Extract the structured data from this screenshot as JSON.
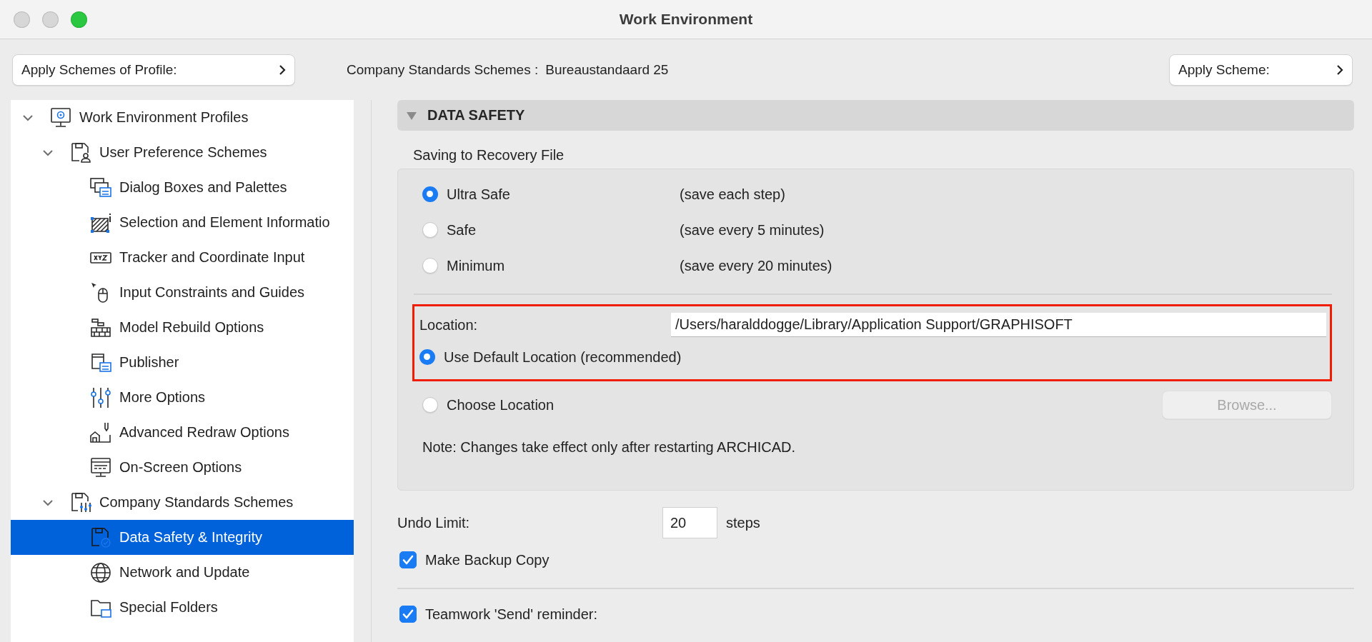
{
  "window": {
    "title": "Work Environment"
  },
  "toolbar": {
    "profile_button": "Apply Schemes of Profile:",
    "scheme_label": "Company Standards Schemes :",
    "scheme_value": "Bureaustandaard 25",
    "apply_button": "Apply Scheme:"
  },
  "tree": [
    {
      "label": "Work Environment Profiles",
      "expanded": true,
      "selected": false,
      "children": [
        {
          "label": "User Preference Schemes",
          "expanded": true,
          "selected": false,
          "children": [
            {
              "label": "Dialog Boxes and Palettes",
              "selected": false
            },
            {
              "label": "Selection and Element Informatio",
              "selected": false
            },
            {
              "label": "Tracker and Coordinate Input",
              "selected": false
            },
            {
              "label": "Input Constraints and Guides",
              "selected": false
            },
            {
              "label": "Model Rebuild Options",
              "selected": false
            },
            {
              "label": "Publisher",
              "selected": false
            },
            {
              "label": "More Options",
              "selected": false
            },
            {
              "label": "Advanced Redraw Options",
              "selected": false
            },
            {
              "label": "On-Screen Options",
              "selected": false
            }
          ]
        },
        {
          "label": "Company Standards Schemes",
          "expanded": true,
          "selected": false,
          "children": [
            {
              "label": "Data Safety & Integrity",
              "selected": true
            },
            {
              "label": "Network and Update",
              "selected": false
            },
            {
              "label": "Special Folders",
              "selected": false
            }
          ]
        }
      ]
    }
  ],
  "section": {
    "title": "DATA SAFETY",
    "expanded": true
  },
  "recovery": {
    "heading": "Saving to Recovery File",
    "options": [
      {
        "label": "Ultra Safe",
        "note": "(save each step)",
        "selected": true
      },
      {
        "label": "Safe",
        "note": "(save every 5 minutes)",
        "selected": false
      },
      {
        "label": "Minimum",
        "note": "(save every 20 minutes)",
        "selected": false
      }
    ]
  },
  "location": {
    "label": "Location:",
    "value": "/Users/haralddogge/Library/Application Support/GRAPHISOFT"
  },
  "location_modes": [
    {
      "label": "Use Default Location (recommended)",
      "selected": true
    },
    {
      "label": "Choose Location",
      "selected": false
    }
  ],
  "browse_button": {
    "label": "Browse...",
    "disabled": true
  },
  "note": "Note: Changes take effect only after restarting ARCHICAD.",
  "undo": {
    "label": "Undo Limit:",
    "value": "20",
    "unit": "steps"
  },
  "checkboxes": [
    {
      "label": "Make Backup Copy",
      "checked": true
    },
    {
      "label": "Teamwork 'Send' reminder:",
      "checked": true
    }
  ]
}
